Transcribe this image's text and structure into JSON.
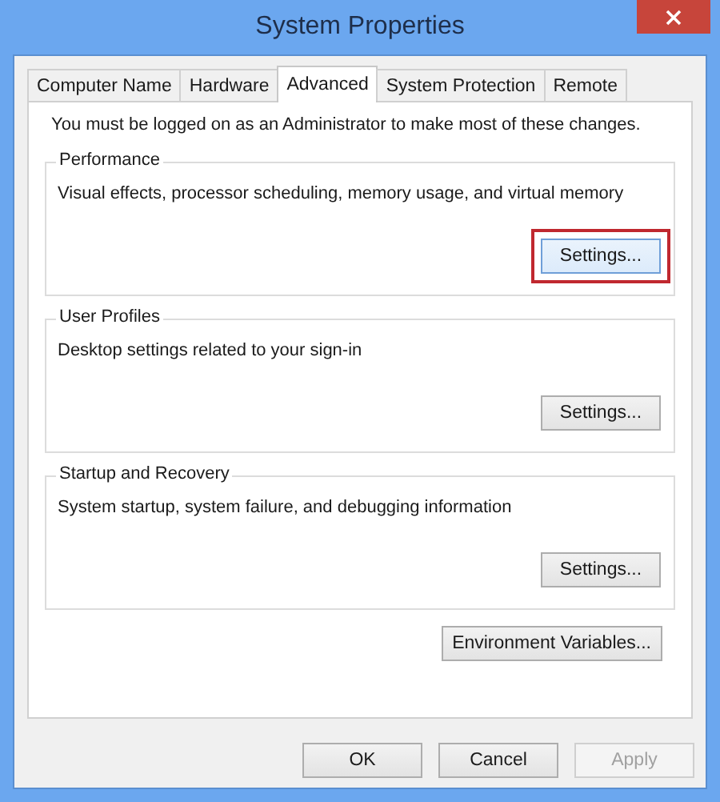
{
  "window": {
    "title": "System Properties"
  },
  "tabs": [
    {
      "label": "Computer Name",
      "selected": false
    },
    {
      "label": "Hardware",
      "selected": false
    },
    {
      "label": "Advanced",
      "selected": true
    },
    {
      "label": "System Protection",
      "selected": false
    },
    {
      "label": "Remote",
      "selected": false
    }
  ],
  "notice": "You must be logged on as an Administrator to make most of these changes.",
  "groups": [
    {
      "title": "Performance",
      "description": "Visual effects, processor scheduling, memory usage, and virtual memory",
      "button": {
        "label": "Settings...",
        "highlighted": true
      }
    },
    {
      "title": "User Profiles",
      "description": "Desktop settings related to your sign-in",
      "button": {
        "label": "Settings...",
        "highlighted": false
      }
    },
    {
      "title": "Startup and Recovery",
      "description": "System startup, system failure, and debugging information",
      "button": {
        "label": "Settings...",
        "highlighted": false
      }
    }
  ],
  "environment_button": {
    "label": "Environment Variables..."
  },
  "buttons": [
    {
      "label": "OK",
      "disabled": false
    },
    {
      "label": "Cancel",
      "disabled": false
    },
    {
      "label": "Apply",
      "disabled": true
    }
  ]
}
